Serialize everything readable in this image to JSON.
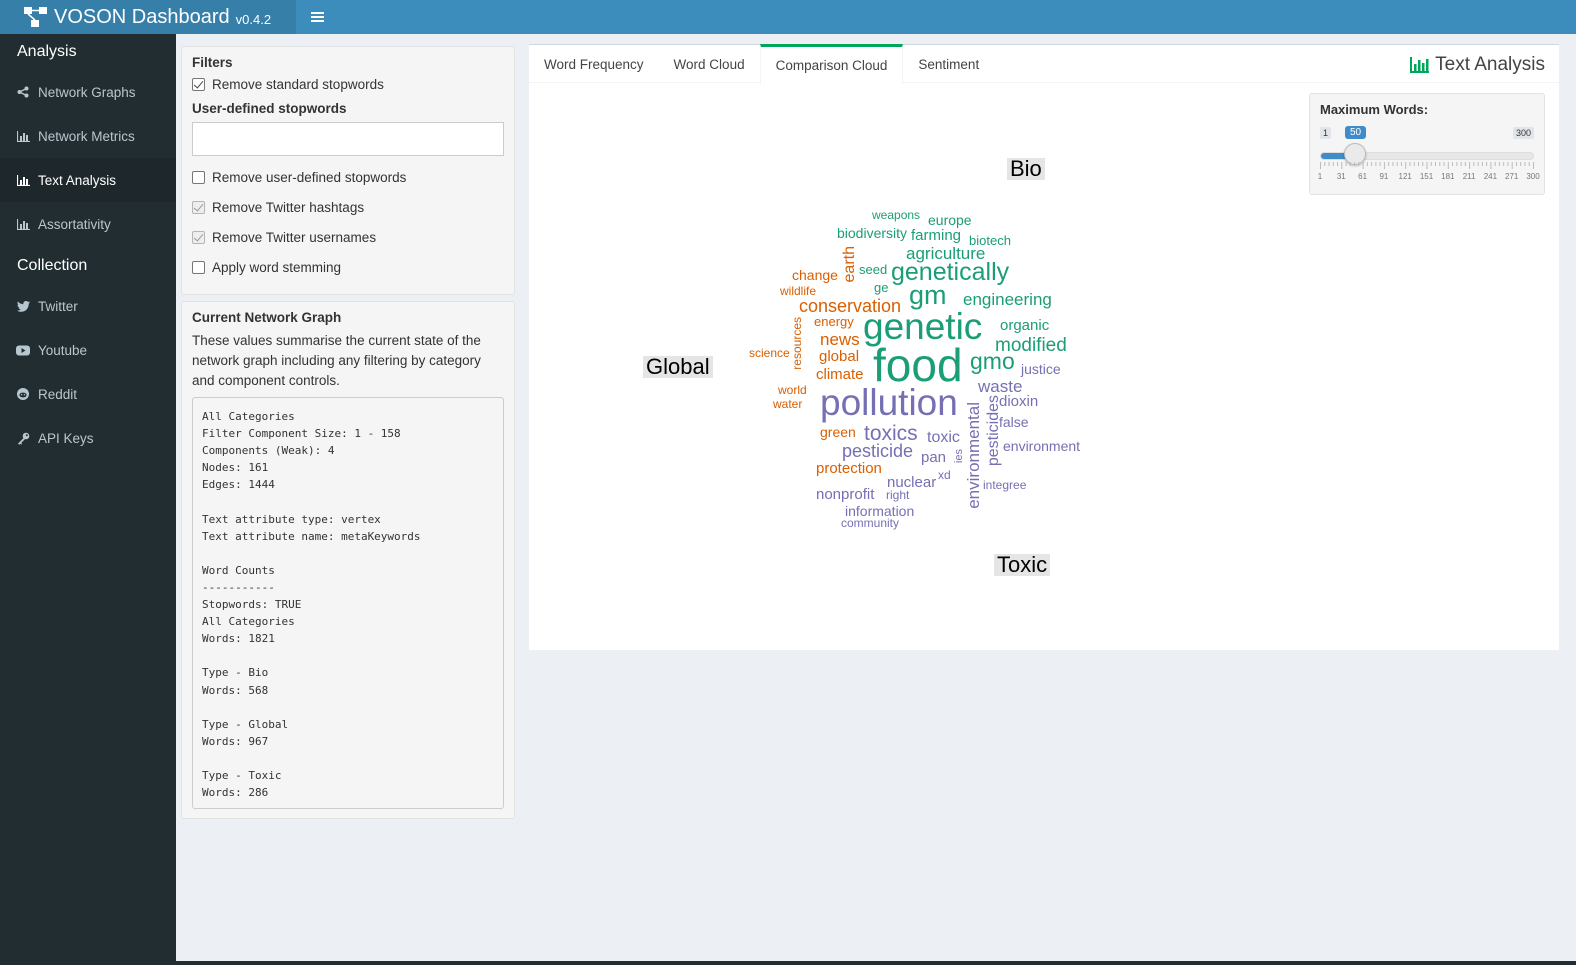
{
  "header": {
    "app_name": "VOSON Dashboard",
    "version": "v0.4.2",
    "menu_icon": "hamburger-icon",
    "colors": {
      "header": "#3c8dbc",
      "logo": "#367fa9"
    }
  },
  "sidebar": {
    "sections": [
      {
        "title": "Analysis",
        "items": [
          {
            "label": "Network Graphs",
            "icon": "share-icon"
          },
          {
            "label": "Network Metrics",
            "icon": "bar-chart-icon"
          },
          {
            "label": "Text Analysis",
            "icon": "bar-chart-icon",
            "active": true
          },
          {
            "label": "Assortativity",
            "icon": "bar-chart-icon"
          }
        ]
      },
      {
        "title": "Collection",
        "items": [
          {
            "label": "Twitter",
            "icon": "twitter-icon"
          },
          {
            "label": "Youtube",
            "icon": "youtube-icon"
          },
          {
            "label": "Reddit",
            "icon": "reddit-icon"
          },
          {
            "label": "API Keys",
            "icon": "key-icon"
          }
        ]
      }
    ]
  },
  "filters": {
    "title": "Filters",
    "remove_standard": {
      "label": "Remove standard stopwords",
      "checked": true
    },
    "user_defined_label": "User-defined stopwords",
    "user_defined_value": "",
    "remove_user_defined": {
      "label": "Remove user-defined stopwords",
      "checked": false
    },
    "remove_hashtags": {
      "label": "Remove Twitter hashtags",
      "checked": true,
      "disabled": true
    },
    "remove_usernames": {
      "label": "Remove Twitter usernames",
      "checked": true,
      "disabled": true
    },
    "stemming": {
      "label": "Apply word stemming",
      "checked": false
    }
  },
  "network_graph": {
    "title": "Current Network Graph",
    "description": "These values summarise the current state of the network graph including any filtering by category and component controls.",
    "summary": "All Categories\nFilter Component Size: 1 - 158\nComponents (Weak): 4\nNodes: 161\nEdges: 1444\n\nText attribute type: vertex\nText attribute name: metaKeywords\n\nWord Counts\n-----------\nStopwords: TRUE\nAll Categories\nWords: 1821\n\nType - Bio\nWords: 568\n\nType - Global\nWords: 967\n\nType - Toxic\nWords: 286"
  },
  "tabs": {
    "items": [
      "Word Frequency",
      "Word Cloud",
      "Comparison Cloud",
      "Sentiment"
    ],
    "active": "Comparison Cloud",
    "title": "Text Analysis",
    "title_icon": "bar-chart-icon"
  },
  "slider": {
    "label": "Maximum Words:",
    "min": 1,
    "max": 300,
    "value": 50,
    "min_label": "1",
    "max_label": "300",
    "value_label": "50",
    "grid_labels": [
      "1",
      "31",
      "61",
      "91",
      "121",
      "151",
      "181",
      "211",
      "241",
      "271",
      "300"
    ],
    "accent": "#428bca"
  },
  "comparison_cloud": {
    "categories": [
      {
        "label": "Bio",
        "color": "#1b9e77"
      },
      {
        "label": "Global",
        "color": "#d95f02"
      },
      {
        "label": "Toxic",
        "color": "#7570b3"
      }
    ],
    "words": [
      {
        "text": "weapons",
        "cat": 0,
        "size": 12
      },
      {
        "text": "europe",
        "cat": 0,
        "size": 14
      },
      {
        "text": "biodiversity",
        "cat": 0,
        "size": 14
      },
      {
        "text": "farming",
        "cat": 0,
        "size": 15
      },
      {
        "text": "biotech",
        "cat": 0,
        "size": 13
      },
      {
        "text": "agriculture",
        "cat": 0,
        "size": 17
      },
      {
        "text": "seed",
        "cat": 0,
        "size": 13
      },
      {
        "text": "genetically",
        "cat": 0,
        "size": 25
      },
      {
        "text": "ge",
        "cat": 0,
        "size": 13
      },
      {
        "text": "gm",
        "cat": 0,
        "size": 27
      },
      {
        "text": "engineering",
        "cat": 0,
        "size": 17
      },
      {
        "text": "genetic",
        "cat": 0,
        "size": 37
      },
      {
        "text": "organic",
        "cat": 0,
        "size": 15
      },
      {
        "text": "modified",
        "cat": 0,
        "size": 19
      },
      {
        "text": "gmo",
        "cat": 0,
        "size": 23
      },
      {
        "text": "food",
        "cat": 0,
        "size": 46
      },
      {
        "text": "change",
        "cat": 1,
        "size": 14
      },
      {
        "text": "earth",
        "cat": 1,
        "size": 16
      },
      {
        "text": "wildlife",
        "cat": 1,
        "size": 12
      },
      {
        "text": "conservation",
        "cat": 1,
        "size": 18
      },
      {
        "text": "energy",
        "cat": 1,
        "size": 13
      },
      {
        "text": "news",
        "cat": 1,
        "size": 17
      },
      {
        "text": "resources",
        "cat": 1,
        "size": 12
      },
      {
        "text": "science",
        "cat": 1,
        "size": 12
      },
      {
        "text": "global",
        "cat": 1,
        "size": 15
      },
      {
        "text": "climate",
        "cat": 1,
        "size": 15
      },
      {
        "text": "world",
        "cat": 1,
        "size": 12
      },
      {
        "text": "water",
        "cat": 1,
        "size": 12
      },
      {
        "text": "green",
        "cat": 1,
        "size": 14
      },
      {
        "text": "protection",
        "cat": 1,
        "size": 15
      },
      {
        "text": "justice",
        "cat": 2,
        "size": 14
      },
      {
        "text": "waste",
        "cat": 2,
        "size": 17
      },
      {
        "text": "pollution",
        "cat": 2,
        "size": 37
      },
      {
        "text": "dioxin",
        "cat": 2,
        "size": 15
      },
      {
        "text": "false",
        "cat": 2,
        "size": 14
      },
      {
        "text": "toxics",
        "cat": 2,
        "size": 21
      },
      {
        "text": "toxic",
        "cat": 2,
        "size": 16
      },
      {
        "text": "environmental",
        "cat": 2,
        "size": 17
      },
      {
        "text": "pesticides",
        "cat": 2,
        "size": 16
      },
      {
        "text": "environment",
        "cat": 2,
        "size": 14
      },
      {
        "text": "pesticide",
        "cat": 2,
        "size": 18
      },
      {
        "text": "pan",
        "cat": 2,
        "size": 15
      },
      {
        "text": "ies",
        "cat": 2,
        "size": 11
      },
      {
        "text": "xd",
        "cat": 2,
        "size": 12
      },
      {
        "text": "nuclear",
        "cat": 2,
        "size": 15
      },
      {
        "text": "integree",
        "cat": 2,
        "size": 12
      },
      {
        "text": "nonprofit",
        "cat": 2,
        "size": 15
      },
      {
        "text": "right",
        "cat": 2,
        "size": 12
      },
      {
        "text": "information",
        "cat": 2,
        "size": 14
      },
      {
        "text": "community",
        "cat": 2,
        "size": 12
      }
    ]
  }
}
